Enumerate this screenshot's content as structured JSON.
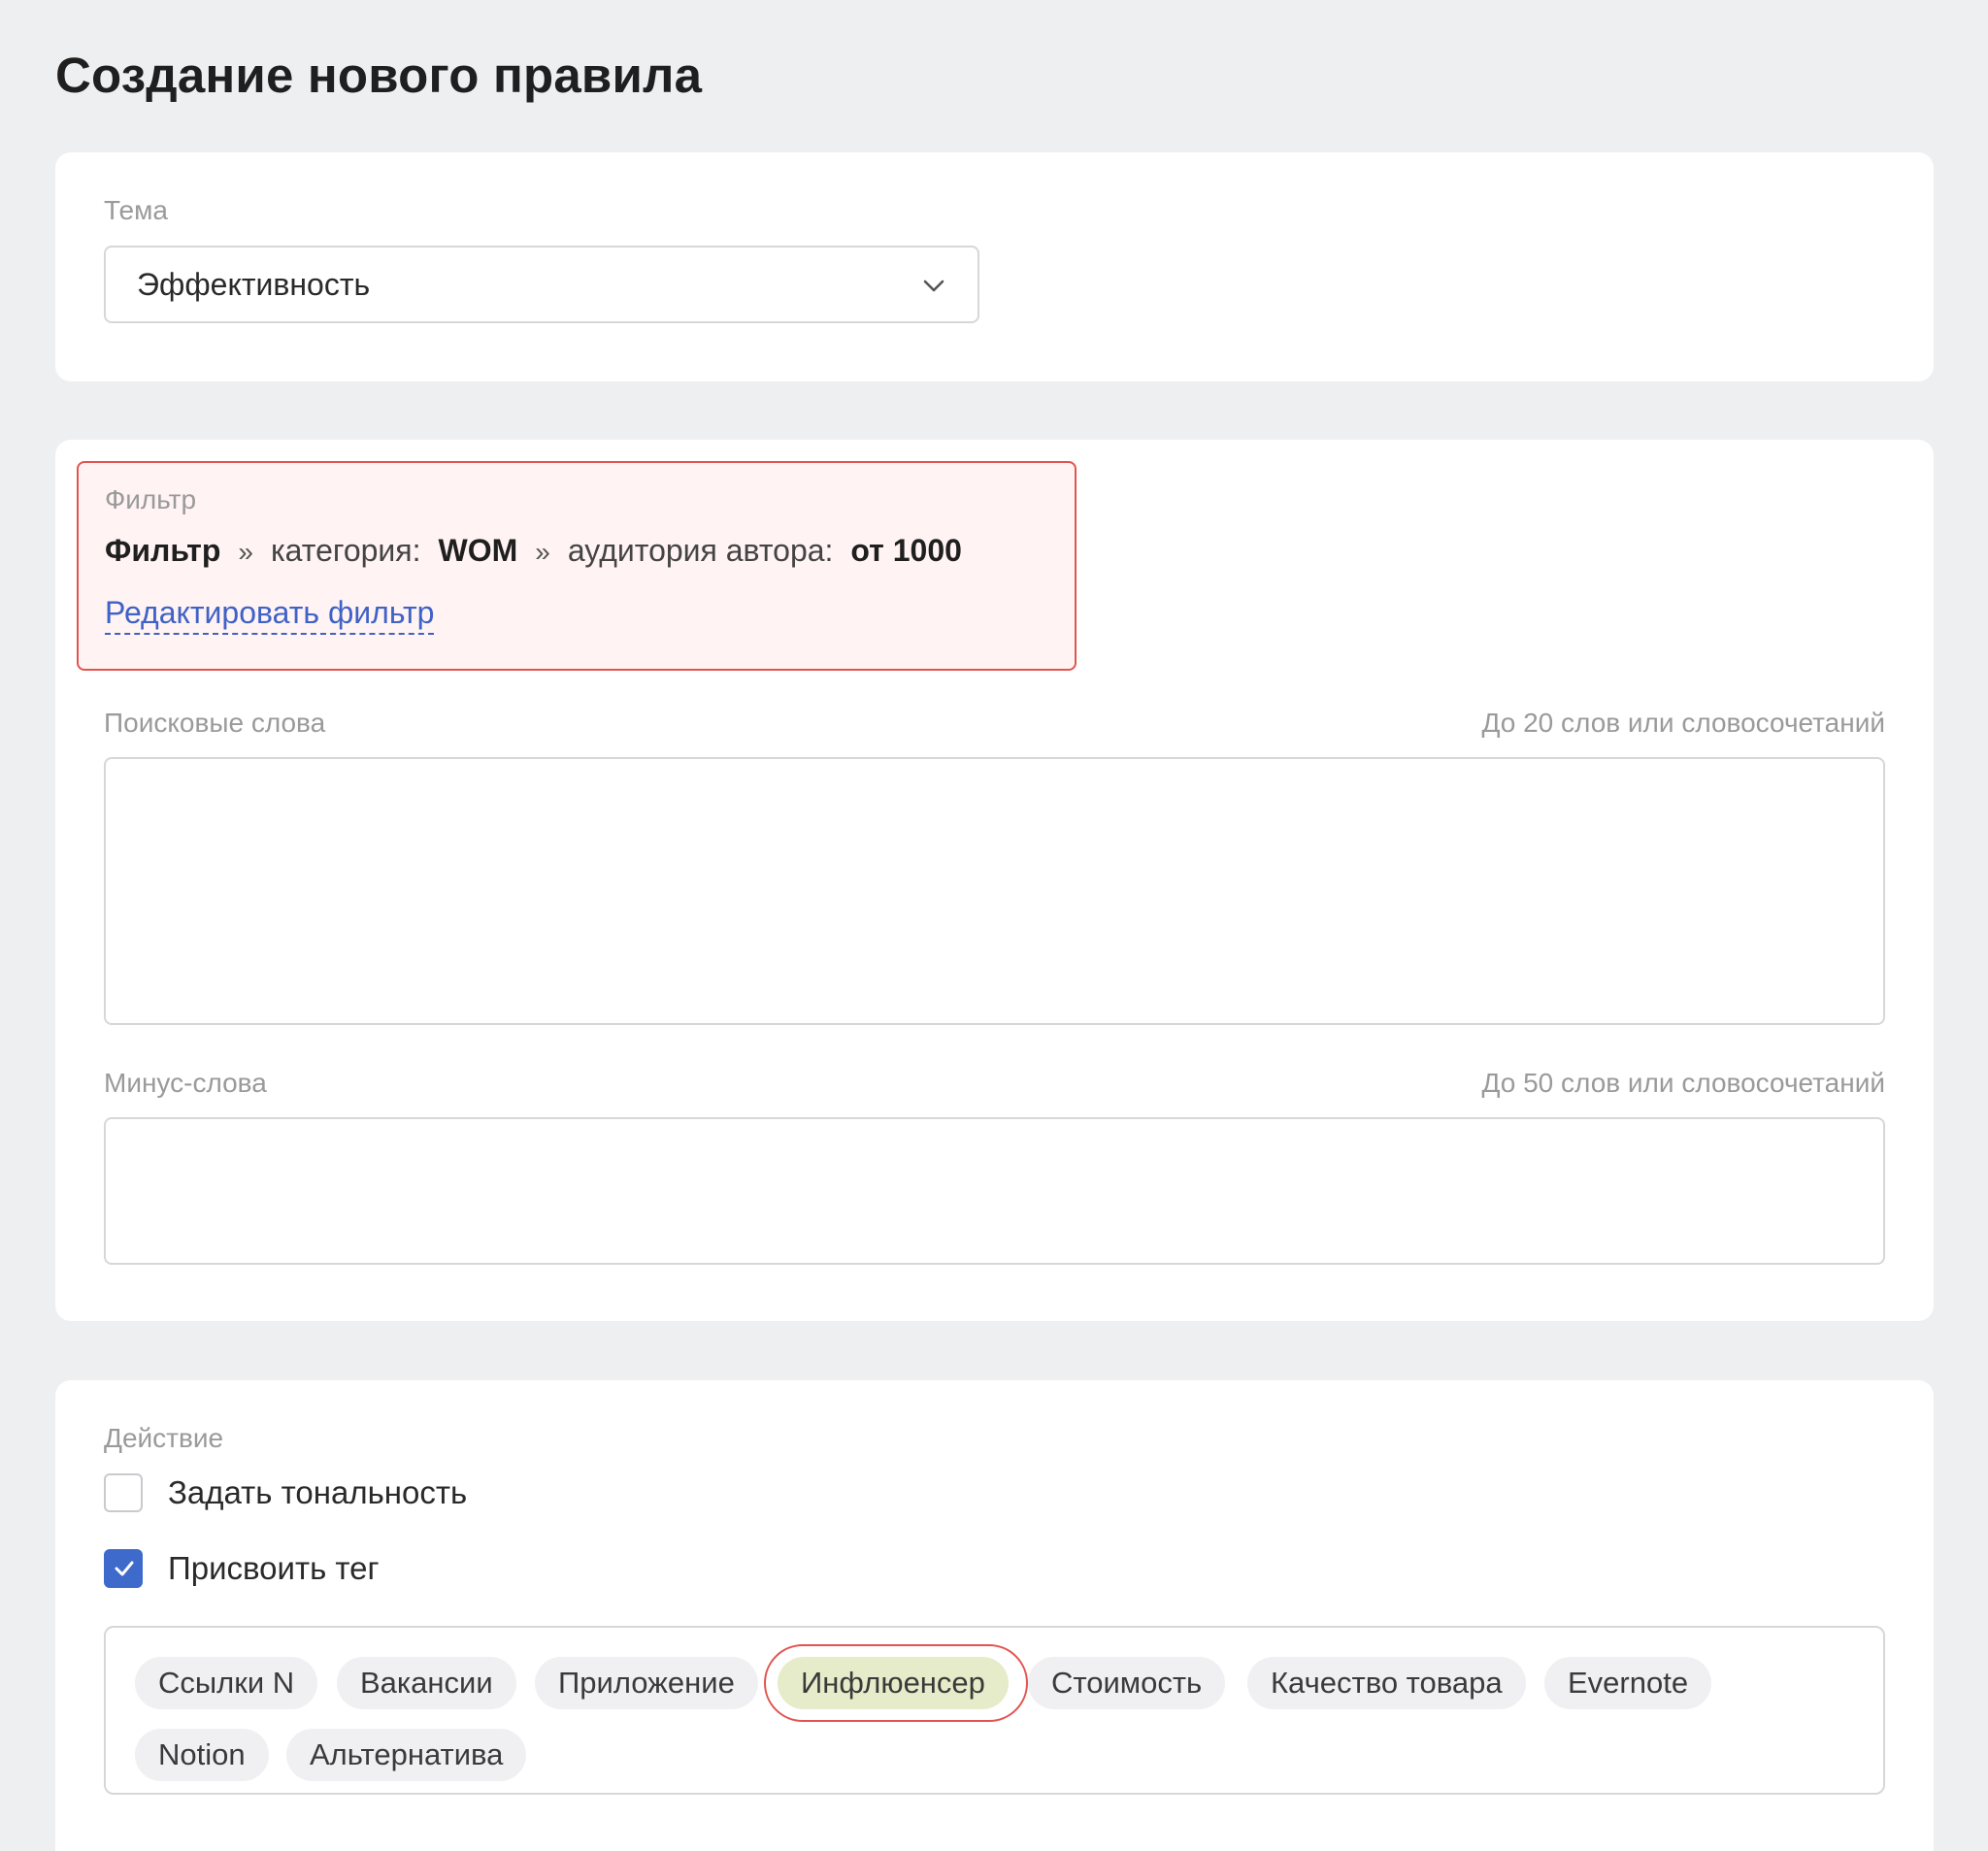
{
  "page": {
    "title": "Создание нового правила"
  },
  "theme": {
    "label": "Тема",
    "selected": "Эффективность"
  },
  "filter": {
    "label": "Фильтр",
    "root": "Фильтр",
    "separator": "»",
    "category_key": "категория:",
    "category_value": "WOM",
    "audience_key": "аудитория автора:",
    "audience_value": "от 1000",
    "edit_link": "Редактировать фильтр",
    "highlight_color": "#e2544f",
    "highlight_bg": "#fff3f3"
  },
  "search_words": {
    "label": "Поисковые слова",
    "hint": "До 20 слов или словосочетаний",
    "value": ""
  },
  "minus_words": {
    "label": "Минус-слова",
    "hint": "До 50 слов или словосочетаний",
    "value": ""
  },
  "action": {
    "label": "Действие",
    "set_tone": {
      "label": "Задать тональность",
      "checked": false
    },
    "assign_tag": {
      "label": "Присвоить тег",
      "checked": true
    },
    "checkbox_color": "#3d6acb"
  },
  "tags": {
    "items": [
      {
        "label": "Ссылки N",
        "selected": false
      },
      {
        "label": "Вакансии",
        "selected": false
      },
      {
        "label": "Приложение",
        "selected": false
      },
      {
        "label": "Инфлюенсер",
        "selected": true
      },
      {
        "label": "Стоимость",
        "selected": false
      },
      {
        "label": "Качество товара",
        "selected": false
      },
      {
        "label": "Evernote",
        "selected": false
      },
      {
        "label": "Notion",
        "selected": false
      },
      {
        "label": "Альтернатива",
        "selected": false
      }
    ],
    "selected_color": "#e6ecc9"
  }
}
